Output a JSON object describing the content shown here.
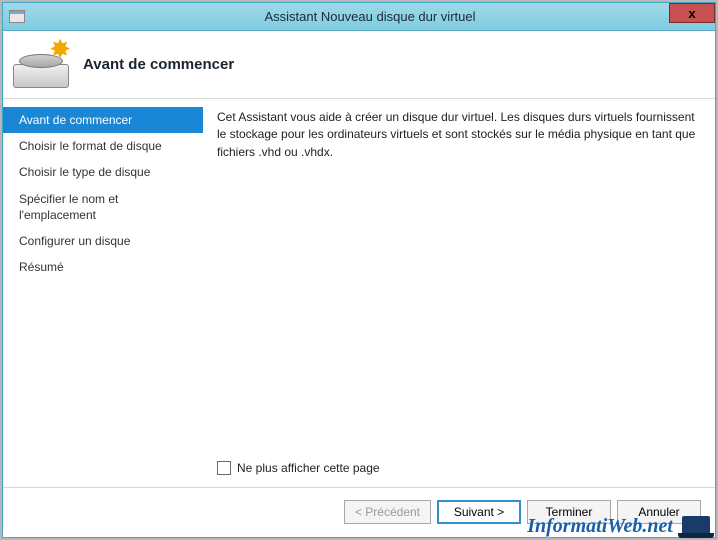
{
  "titlebar": {
    "title": "Assistant Nouveau disque dur virtuel",
    "close_symbol": "x"
  },
  "header": {
    "heading": "Avant de commencer",
    "icon_star": "✸"
  },
  "sidebar": {
    "steps": [
      "Avant de commencer",
      "Choisir le format de disque",
      "Choisir le type de disque",
      "Spécifier le nom et l'emplacement",
      "Configurer un disque",
      "Résumé"
    ],
    "active_index": 0
  },
  "content": {
    "description": "Cet Assistant vous aide à créer un disque dur virtuel. Les disques durs virtuels fournissent le stockage pour les ordinateurs virtuels et sont stockés sur le média physique en tant que fichiers .vhd ou .vhdx.",
    "checkbox_label": "Ne plus afficher cette page",
    "checkbox_checked": false
  },
  "footer": {
    "previous_label": "< Précédent",
    "next_label": "Suivant >",
    "finish_label": "Terminer",
    "cancel_label": "Annuler"
  },
  "watermark": {
    "text": "InformatiWeb.net"
  }
}
